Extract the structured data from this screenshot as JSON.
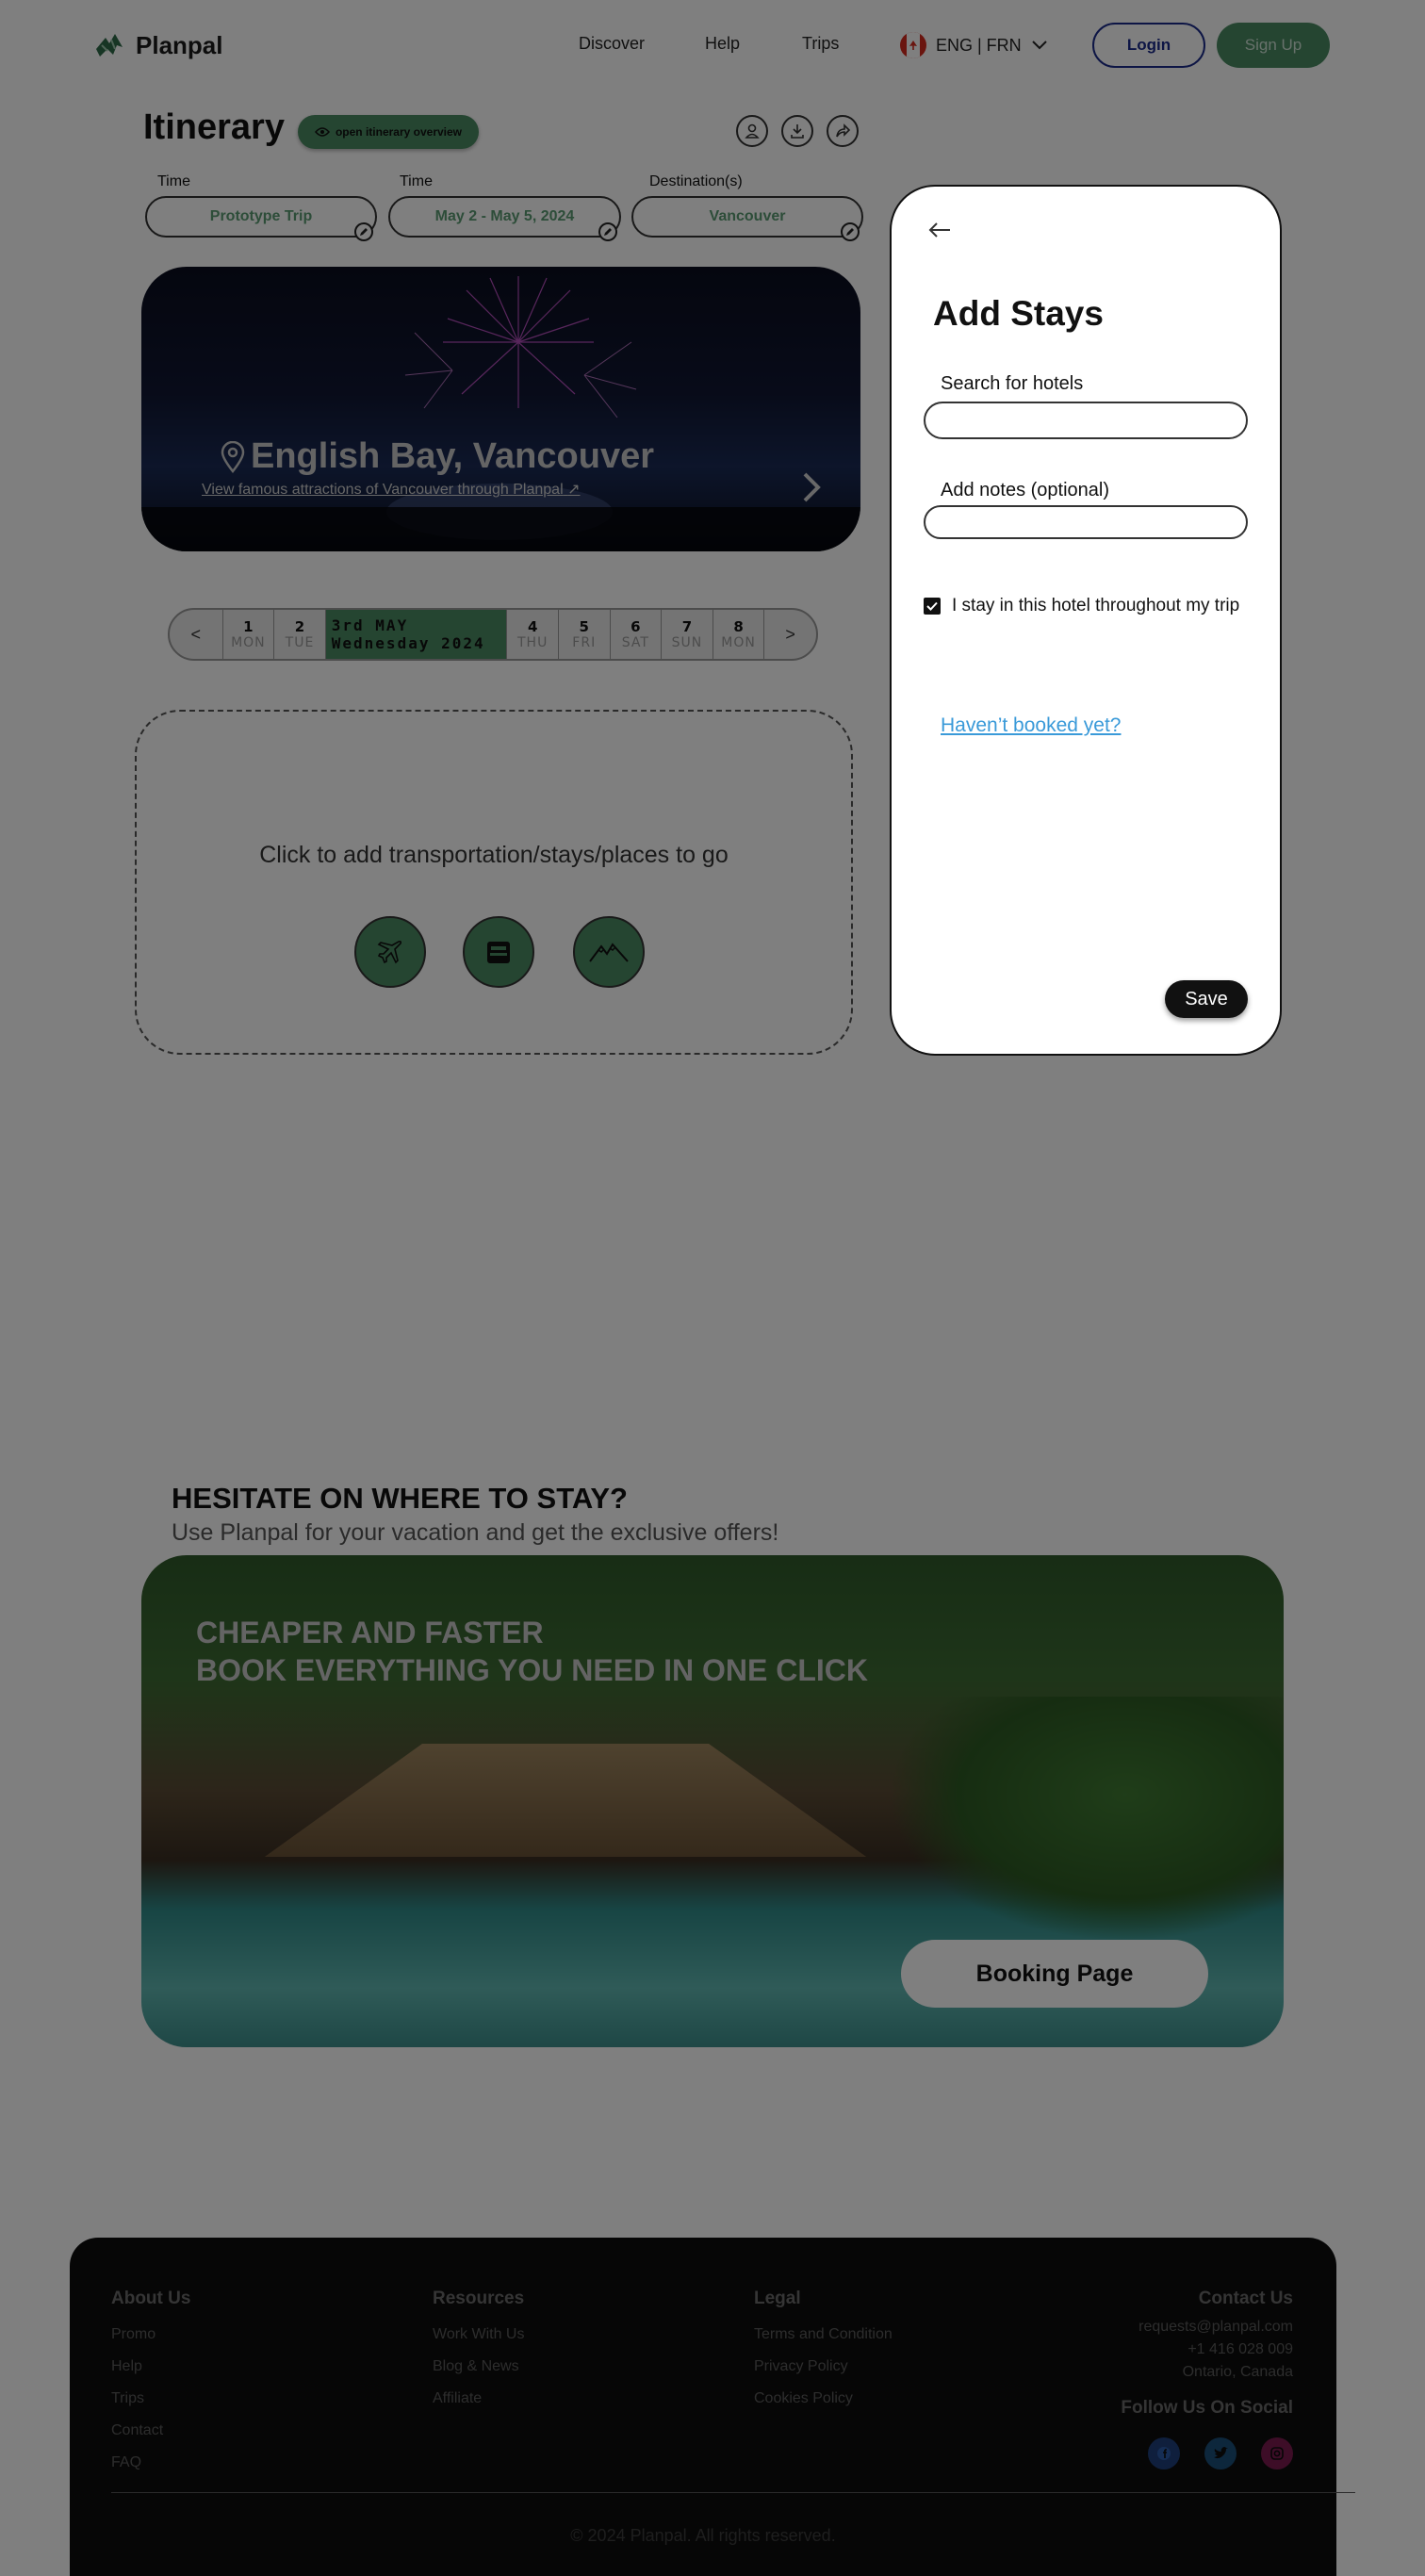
{
  "nav": {
    "brand": "Planpal",
    "links": [
      "Discover",
      "Help",
      "Trips"
    ],
    "language": "ENG | FRN",
    "login": "Login",
    "signup": "Sign Up"
  },
  "itinerary": {
    "title": "Itinerary",
    "overview_button": "open itinerary overview",
    "fields": [
      {
        "label": "Time",
        "value": "Prototype Trip"
      },
      {
        "label": "Time",
        "value": "May 2 - May 5, 2024"
      },
      {
        "label": "Destination(s)",
        "value": "Vancouver"
      }
    ],
    "hero": {
      "title": "English Bay, Vancouver",
      "subtitle": "View famous attractions of Vancouver through Planpal"
    }
  },
  "dates": {
    "prev": "<",
    "next": ">",
    "before": [
      {
        "num": "1",
        "day": "MON"
      },
      {
        "num": "2",
        "day": "TUE"
      }
    ],
    "selected": {
      "line1": "3rd MAY",
      "line2": "Wednesday 2024"
    },
    "after": [
      {
        "num": "4",
        "day": "THU"
      },
      {
        "num": "5",
        "day": "FRI"
      },
      {
        "num": "6",
        "day": "SAT"
      },
      {
        "num": "7",
        "day": "SUN"
      },
      {
        "num": "8",
        "day": "MON"
      }
    ]
  },
  "add_box": {
    "text": "Click to add transportation/stays/places to go",
    "icons": [
      "airplane-icon",
      "hotel-icon",
      "mountain-icon"
    ]
  },
  "modal": {
    "title": "Add Stays",
    "search_label": "Search for hotels",
    "search_value": "",
    "notes_label": "Add notes (optional)",
    "notes_value": "",
    "checkbox_label": "I stay in this hotel throughout my trip",
    "checkbox_checked": true,
    "link": "Haven’t booked yet?",
    "save": "Save"
  },
  "promo": {
    "title": "HESITATE ON WHERE TO STAY?",
    "subtitle": "Use Planpal for your vacation and get the exclusive offers!",
    "banner_line1": "CHEAPER AND FASTER",
    "banner_line2": "BOOK EVERYTHING YOU NEED IN ONE CLICK",
    "button": "Booking Page"
  },
  "footer": {
    "about": {
      "title": "About Us",
      "items": [
        "Promo",
        "Help",
        "Trips",
        "Contact",
        "FAQ"
      ]
    },
    "resources": {
      "title": "Resources",
      "items": [
        "Work With Us",
        "Blog & News",
        "Affiliate"
      ]
    },
    "legal": {
      "title": "Legal",
      "items": [
        "Terms and Condition",
        "Privacy Policy",
        "Cookies Policy"
      ]
    },
    "contact": {
      "title": "Contact Us",
      "email": "requests@planpal.com",
      "phone": "+1 416 028 009",
      "location": "Ontario, Canada"
    },
    "social_title": "Follow Us On Social",
    "copyright": "© 2024 Planpal. All rights reserved."
  },
  "colors": {
    "accent": "#4a8a62",
    "link": "#3a9ad9",
    "login": "#1a2a8a"
  }
}
